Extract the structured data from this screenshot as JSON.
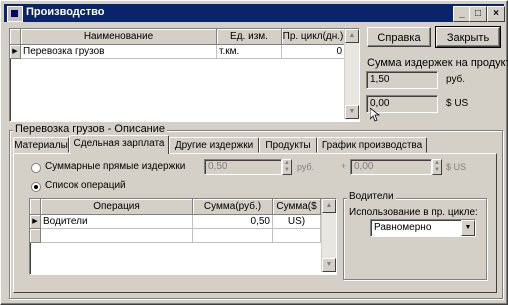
{
  "window": {
    "title": "Производство",
    "controls": {
      "minimize": "_",
      "maximize": "□",
      "close": "×"
    }
  },
  "top_grid": {
    "columns": [
      "Наименование",
      "Ед. изм.",
      "Пр. цикл(дн.)"
    ],
    "rows": [
      {
        "name": "Перевозка грузов",
        "unit": "т.км.",
        "cycle": "0"
      }
    ]
  },
  "buttons": {
    "help": "Справка",
    "close": "Закрыть"
  },
  "cost_panel": {
    "label": "Сумма издержек на продукт:",
    "rub_value": "1,50",
    "rub_unit": "руб.",
    "usd_value": "0,00",
    "usd_unit": "$ US"
  },
  "description": {
    "group_title": "Перевозка грузов - Описание",
    "tabs": [
      "Материалы",
      "Сдельная зарплата",
      "Другие издержки",
      "Продукты",
      "График производства"
    ],
    "active_tab": 1,
    "direct_costs": {
      "label": "Суммарные прямые издержки",
      "rub_value": "0,50",
      "rub_unit": "руб.",
      "usd_value": "0,00",
      "usd_unit": "$ US"
    },
    "ops_label": "Список операций",
    "ops_grid": {
      "columns": [
        "Операция",
        "Сумма(руб.)",
        "Сумма($ US)"
      ],
      "rows": [
        {
          "op": "Водители",
          "rub": "0,50",
          "usd": ""
        }
      ]
    },
    "drivers": {
      "group_title": "Водители",
      "label": "Использование в пр. цикле:",
      "selected": "Равномерно"
    }
  }
}
